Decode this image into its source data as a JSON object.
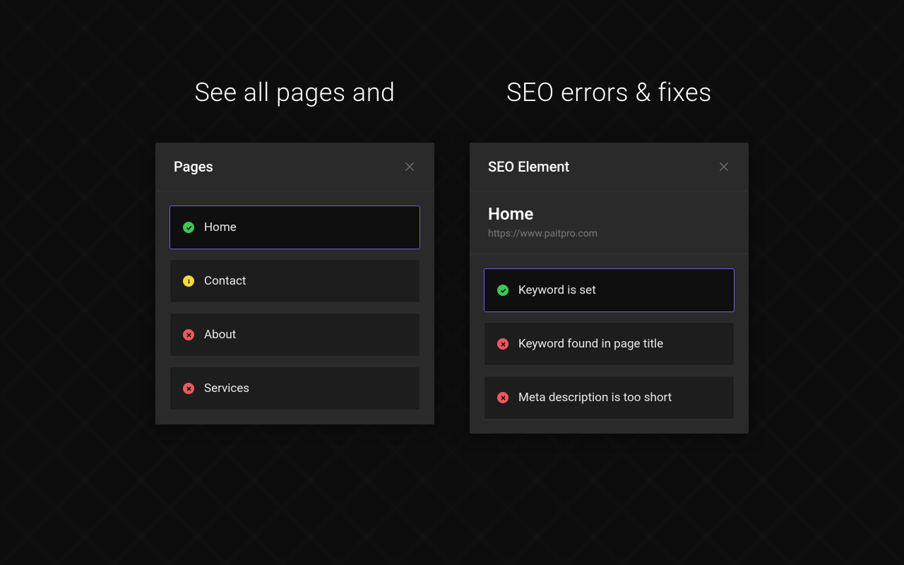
{
  "left": {
    "headline": "See all pages and",
    "panel_title": "Pages",
    "items": [
      {
        "label": "Home",
        "status": "success",
        "selected": true
      },
      {
        "label": "Contact",
        "status": "warning",
        "selected": false
      },
      {
        "label": "About",
        "status": "error",
        "selected": false
      },
      {
        "label": "Services",
        "status": "error",
        "selected": false
      }
    ]
  },
  "right": {
    "headline": "SEO errors & fixes",
    "panel_title": "SEO Element",
    "page_title": "Home",
    "page_url": "https://www.paitpro.com",
    "items": [
      {
        "label": "Keyword is set",
        "status": "success",
        "selected": true
      },
      {
        "label": "Keyword found in page title",
        "status": "error",
        "selected": false
      },
      {
        "label": "Meta description is too short",
        "status": "error",
        "selected": false
      }
    ]
  }
}
